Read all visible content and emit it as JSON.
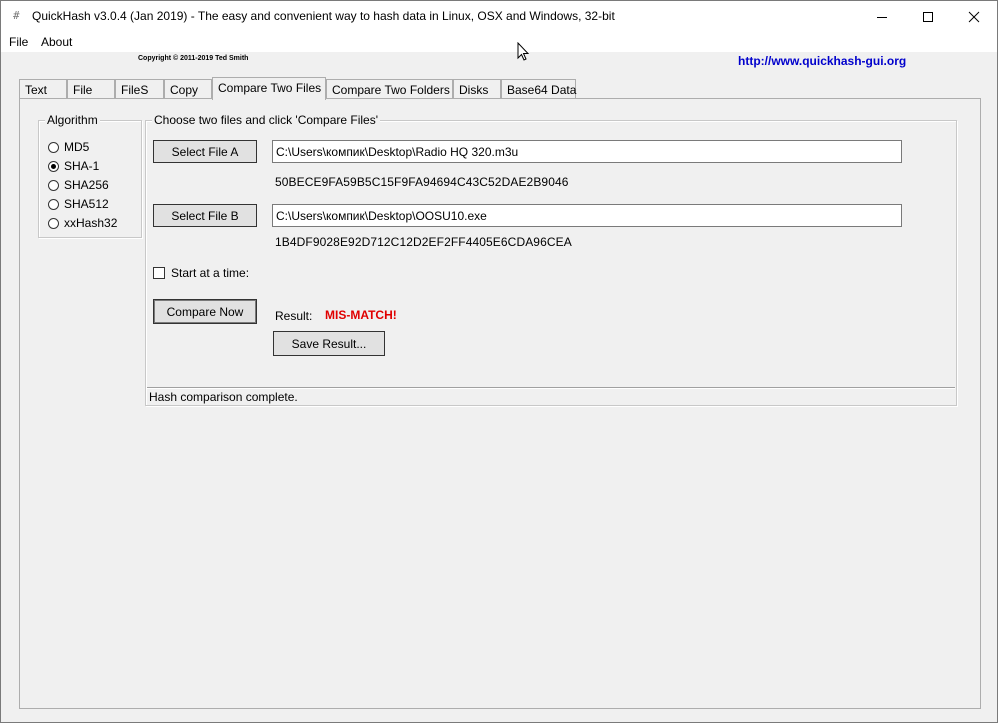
{
  "window": {
    "title": "QuickHash v3.0.4 (Jan 2019) - The easy and convenient way to hash data in Linux, OSX and Windows, 32-bit",
    "app_icon": "#",
    "controls": [
      "minimize-icon",
      "maximize-icon",
      "close-icon"
    ]
  },
  "menu": {
    "items": [
      "File",
      "About"
    ]
  },
  "header": {
    "copyright": "Copyright © 2011-2019  Ted Smith",
    "url": "http://www.quickhash-gui.org",
    "url_color": "#0000cc"
  },
  "tabs": [
    {
      "label": "Text"
    },
    {
      "label": "File"
    },
    {
      "label": "FileS"
    },
    {
      "label": "Copy"
    },
    {
      "label": "Compare Two Files",
      "active": true
    },
    {
      "label": "Compare Two Folders"
    },
    {
      "label": "Disks"
    },
    {
      "label": "Base64 Data"
    }
  ],
  "algorithm": {
    "legend": "Algorithm",
    "options": [
      "MD5",
      "SHA-1",
      "SHA256",
      "SHA512",
      "xxHash32"
    ],
    "selected": "SHA-1"
  },
  "compare": {
    "legend": "Choose two files and click 'Compare Files'",
    "file_a": {
      "button": "Select File A",
      "path": "C:\\Users\\компик\\Desktop\\Radio HQ 320.m3u",
      "hash": "50BECE9FA59B5C15F9FA94694C43C52DAE2B9046"
    },
    "file_b": {
      "button": "Select File B",
      "path": "C:\\Users\\компик\\Desktop\\OOSU10.exe",
      "hash": "1B4DF9028E92D712C12D2EF2FF4405E6CDA96CEA"
    },
    "start_at_time": {
      "label": "Start at a time:",
      "checked": false
    },
    "compare_button": "Compare Now",
    "result_label": "Result:",
    "result_value": "MIS-MATCH!",
    "result_color": "#e00000",
    "save_button": "Save Result...",
    "status": "Hash comparison complete."
  }
}
